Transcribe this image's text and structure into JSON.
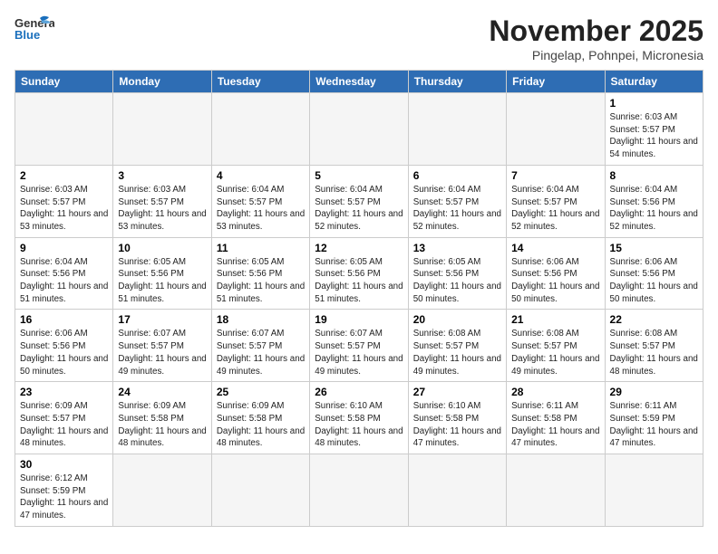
{
  "header": {
    "logo_general": "General",
    "logo_blue": "Blue",
    "month_title": "November 2025",
    "location": "Pingelap, Pohnpei, Micronesia"
  },
  "days_of_week": [
    "Sunday",
    "Monday",
    "Tuesday",
    "Wednesday",
    "Thursday",
    "Friday",
    "Saturday"
  ],
  "weeks": [
    [
      {
        "day": "",
        "info": ""
      },
      {
        "day": "",
        "info": ""
      },
      {
        "day": "",
        "info": ""
      },
      {
        "day": "",
        "info": ""
      },
      {
        "day": "",
        "info": ""
      },
      {
        "day": "",
        "info": ""
      },
      {
        "day": "1",
        "info": "Sunrise: 6:03 AM\nSunset: 5:57 PM\nDaylight: 11 hours\nand 54 minutes."
      }
    ],
    [
      {
        "day": "2",
        "info": "Sunrise: 6:03 AM\nSunset: 5:57 PM\nDaylight: 11 hours\nand 53 minutes."
      },
      {
        "day": "3",
        "info": "Sunrise: 6:03 AM\nSunset: 5:57 PM\nDaylight: 11 hours\nand 53 minutes."
      },
      {
        "day": "4",
        "info": "Sunrise: 6:04 AM\nSunset: 5:57 PM\nDaylight: 11 hours\nand 53 minutes."
      },
      {
        "day": "5",
        "info": "Sunrise: 6:04 AM\nSunset: 5:57 PM\nDaylight: 11 hours\nand 52 minutes."
      },
      {
        "day": "6",
        "info": "Sunrise: 6:04 AM\nSunset: 5:57 PM\nDaylight: 11 hours\nand 52 minutes."
      },
      {
        "day": "7",
        "info": "Sunrise: 6:04 AM\nSunset: 5:57 PM\nDaylight: 11 hours\nand 52 minutes."
      },
      {
        "day": "8",
        "info": "Sunrise: 6:04 AM\nSunset: 5:56 PM\nDaylight: 11 hours\nand 52 minutes."
      }
    ],
    [
      {
        "day": "9",
        "info": "Sunrise: 6:04 AM\nSunset: 5:56 PM\nDaylight: 11 hours\nand 51 minutes."
      },
      {
        "day": "10",
        "info": "Sunrise: 6:05 AM\nSunset: 5:56 PM\nDaylight: 11 hours\nand 51 minutes."
      },
      {
        "day": "11",
        "info": "Sunrise: 6:05 AM\nSunset: 5:56 PM\nDaylight: 11 hours\nand 51 minutes."
      },
      {
        "day": "12",
        "info": "Sunrise: 6:05 AM\nSunset: 5:56 PM\nDaylight: 11 hours\nand 51 minutes."
      },
      {
        "day": "13",
        "info": "Sunrise: 6:05 AM\nSunset: 5:56 PM\nDaylight: 11 hours\nand 50 minutes."
      },
      {
        "day": "14",
        "info": "Sunrise: 6:06 AM\nSunset: 5:56 PM\nDaylight: 11 hours\nand 50 minutes."
      },
      {
        "day": "15",
        "info": "Sunrise: 6:06 AM\nSunset: 5:56 PM\nDaylight: 11 hours\nand 50 minutes."
      }
    ],
    [
      {
        "day": "16",
        "info": "Sunrise: 6:06 AM\nSunset: 5:56 PM\nDaylight: 11 hours\nand 50 minutes."
      },
      {
        "day": "17",
        "info": "Sunrise: 6:07 AM\nSunset: 5:57 PM\nDaylight: 11 hours\nand 49 minutes."
      },
      {
        "day": "18",
        "info": "Sunrise: 6:07 AM\nSunset: 5:57 PM\nDaylight: 11 hours\nand 49 minutes."
      },
      {
        "day": "19",
        "info": "Sunrise: 6:07 AM\nSunset: 5:57 PM\nDaylight: 11 hours\nand 49 minutes."
      },
      {
        "day": "20",
        "info": "Sunrise: 6:08 AM\nSunset: 5:57 PM\nDaylight: 11 hours\nand 49 minutes."
      },
      {
        "day": "21",
        "info": "Sunrise: 6:08 AM\nSunset: 5:57 PM\nDaylight: 11 hours\nand 49 minutes."
      },
      {
        "day": "22",
        "info": "Sunrise: 6:08 AM\nSunset: 5:57 PM\nDaylight: 11 hours\nand 48 minutes."
      }
    ],
    [
      {
        "day": "23",
        "info": "Sunrise: 6:09 AM\nSunset: 5:57 PM\nDaylight: 11 hours\nand 48 minutes."
      },
      {
        "day": "24",
        "info": "Sunrise: 6:09 AM\nSunset: 5:58 PM\nDaylight: 11 hours\nand 48 minutes."
      },
      {
        "day": "25",
        "info": "Sunrise: 6:09 AM\nSunset: 5:58 PM\nDaylight: 11 hours\nand 48 minutes."
      },
      {
        "day": "26",
        "info": "Sunrise: 6:10 AM\nSunset: 5:58 PM\nDaylight: 11 hours\nand 48 minutes."
      },
      {
        "day": "27",
        "info": "Sunrise: 6:10 AM\nSunset: 5:58 PM\nDaylight: 11 hours\nand 47 minutes."
      },
      {
        "day": "28",
        "info": "Sunrise: 6:11 AM\nSunset: 5:58 PM\nDaylight: 11 hours\nand 47 minutes."
      },
      {
        "day": "29",
        "info": "Sunrise: 6:11 AM\nSunset: 5:59 PM\nDaylight: 11 hours\nand 47 minutes."
      }
    ],
    [
      {
        "day": "30",
        "info": "Sunrise: 6:12 AM\nSunset: 5:59 PM\nDaylight: 11 hours\nand 47 minutes."
      },
      {
        "day": "",
        "info": ""
      },
      {
        "day": "",
        "info": ""
      },
      {
        "day": "",
        "info": ""
      },
      {
        "day": "",
        "info": ""
      },
      {
        "day": "",
        "info": ""
      },
      {
        "day": "",
        "info": ""
      }
    ]
  ]
}
